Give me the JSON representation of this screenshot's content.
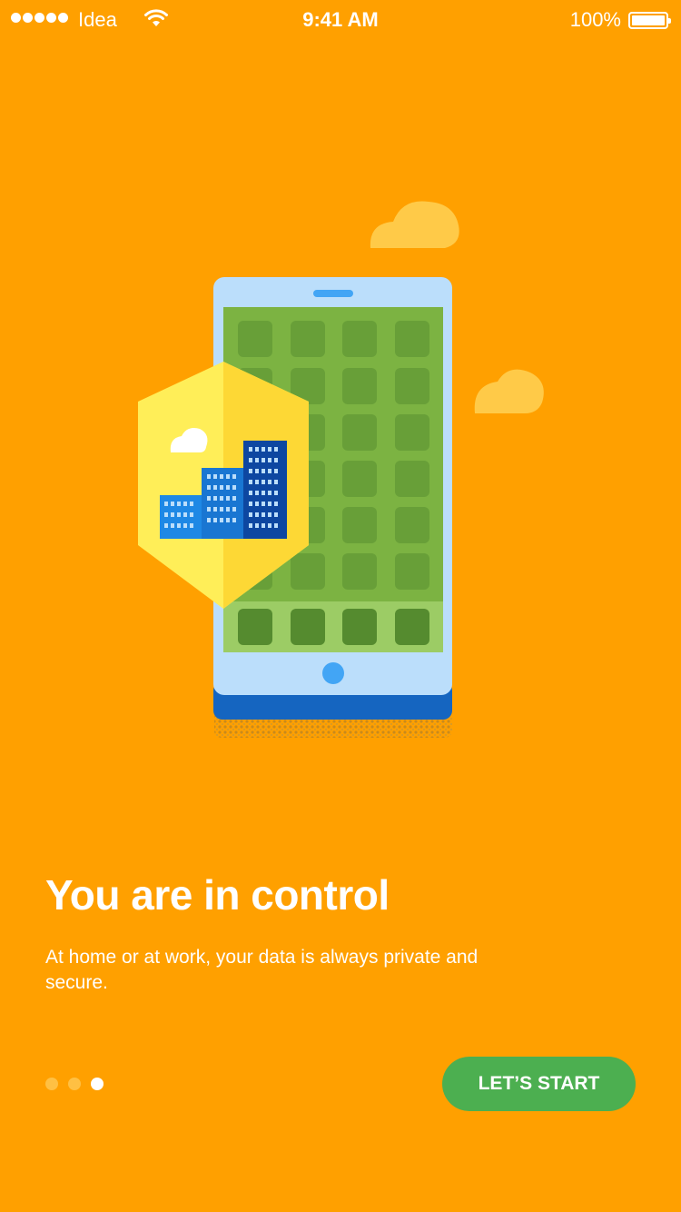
{
  "status_bar": {
    "carrier": "Idea",
    "time": "9:41 AM",
    "battery_percent": "100%",
    "battery_level": 1.0,
    "signal_bars": 5
  },
  "onboarding": {
    "title": "You are in control",
    "description": "At home or at work, your data is always private and secure.",
    "page_indicator": {
      "total": 3,
      "current": 3
    },
    "start_button_label": "LET’S START"
  },
  "colors": {
    "background": "#FFA000",
    "button": "#4CAF50",
    "text": "#FFFFFF"
  }
}
